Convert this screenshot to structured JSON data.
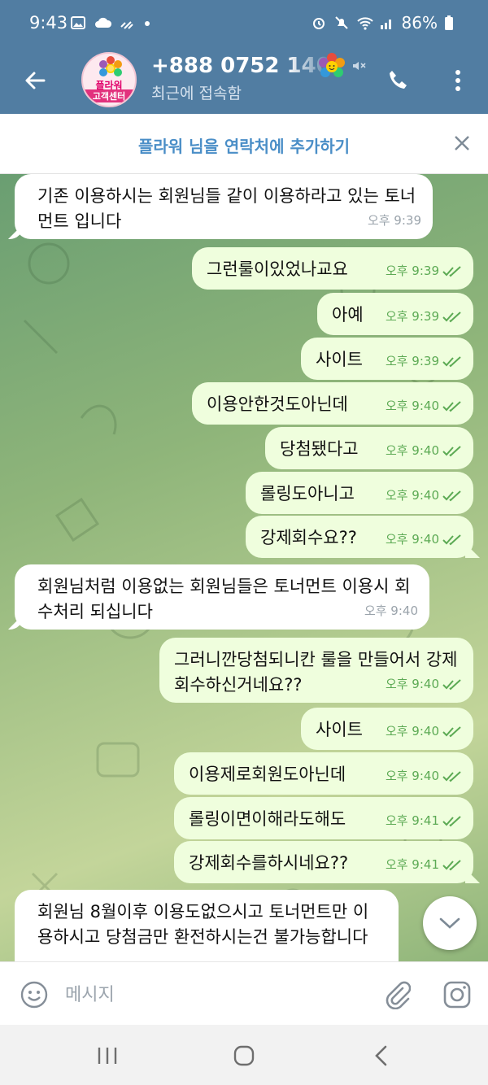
{
  "status_bar": {
    "time": "9:43",
    "battery": "86%",
    "left_icons": [
      "image-icon",
      "cloud-icon",
      "signal-wave-icon",
      "dot-icon"
    ],
    "right_icons": [
      "alarm-icon",
      "mute-icon",
      "wifi-icon",
      "cell-signal-icon",
      "battery-icon"
    ]
  },
  "header": {
    "contact_name": "+888 0752 1408",
    "contact_status": "최근에 접속함",
    "avatar_line1": "플라워",
    "avatar_line2": "고객센터"
  },
  "banner": {
    "add_contact": "플라워 님을 연락처에 추가하기"
  },
  "messages": [
    {
      "text": "기존 이용하시는 회원님들 같이 이용하라고 있는 토너먼트 입니다",
      "time": "오후 9:39"
    },
    {
      "text": "그런룰이있었나교요",
      "time": "오후 9:39"
    },
    {
      "text": "아예",
      "time": "오후 9:39"
    },
    {
      "text": "사이트",
      "time": "오후 9:39"
    },
    {
      "text": "이용안한것도아닌데",
      "time": "오후 9:40"
    },
    {
      "text": "당첨됐다고",
      "time": "오후 9:40"
    },
    {
      "text": "롤링도아니고",
      "time": "오후 9:40"
    },
    {
      "text": "강제회수요??",
      "time": "오후 9:40"
    },
    {
      "text": "회원님처럼 이용없는 회원님들은 토너먼트 이용시 회수처리 되십니다",
      "time": "오후 9:40"
    },
    {
      "text": "그러니깐당첨되니칸 룰을 만들어서 강제회수하신거네요??",
      "time": "오후 9:40"
    },
    {
      "text": "사이트",
      "time": "오후 9:40"
    },
    {
      "text": "이용제로회원도아닌데",
      "time": "오후 9:40"
    },
    {
      "text": "롤링이면이해라도해도",
      "time": "오후 9:41"
    },
    {
      "text": "강제회수를하시네요??",
      "time": "오후 9:41"
    },
    {
      "text": "회원님 8월이후 이용도없으시고 토너먼트만 이용하시고 당첨금만 환전하시는건 불가능합니다",
      "time": ""
    }
  ],
  "input": {
    "placeholder": "메시지"
  },
  "colors": {
    "header": "#517da2",
    "incoming_bubble": "#ffffff",
    "outgoing_bubble": "#effedd",
    "outgoing_meta": "#5caa54",
    "banner_text": "#4a8ec7"
  }
}
